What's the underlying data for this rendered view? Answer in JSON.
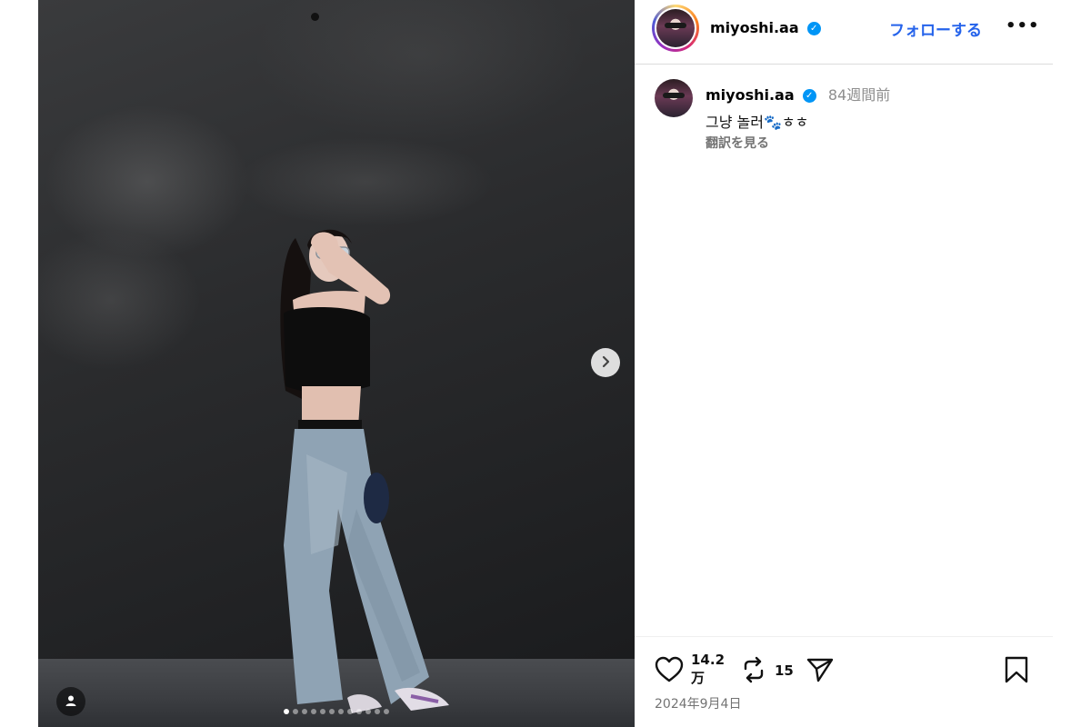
{
  "post": {
    "username": "miyoshi.aa",
    "follow_label": "フォローする",
    "more_label": "•••",
    "time_ago": "84週間前",
    "caption": "그냥 놀러🐾ㅎㅎ",
    "translate_label": "翻訳を見る",
    "likes": "14.2\n万",
    "likes_line1": "14.2",
    "likes_line2": "万",
    "reposts": "15",
    "date": "2024年9月4日"
  },
  "carousel": {
    "slide_count": 12,
    "active_index": 0
  },
  "colors": {
    "accent": "#2563eb",
    "verified": "#0095f6",
    "muted": "#737373"
  },
  "icons": {
    "like": "heart-icon",
    "repost": "repost-icon",
    "share": "share-icon",
    "save": "bookmark-icon",
    "next": "chevron-right-icon",
    "tag": "user-tag-icon",
    "verified": "verified-badge-icon"
  }
}
